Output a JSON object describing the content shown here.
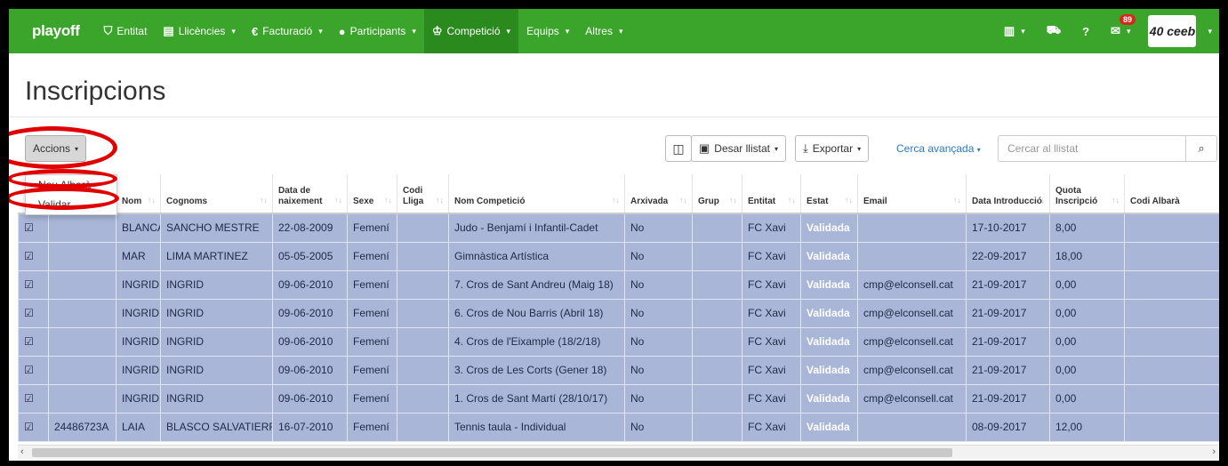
{
  "navbar": {
    "brand": "playoff",
    "items": [
      {
        "label": "Entitat",
        "icon": "⛉",
        "icon_name": "shield-icon"
      },
      {
        "label": "Llicències",
        "icon": "▤",
        "icon_name": "id-card-icon"
      },
      {
        "label": "Facturació",
        "icon": "€",
        "icon_name": "euro-icon"
      },
      {
        "label": "Participants",
        "icon": "●",
        "icon_name": "user-icon"
      },
      {
        "label": "Competició",
        "icon": "♔",
        "icon_name": "trophy-icon"
      },
      {
        "label": "Equips",
        "icon": "",
        "icon_name": ""
      },
      {
        "label": "Altres",
        "icon": "",
        "icon_name": ""
      }
    ],
    "mail_badge": "89",
    "logo_text": "40 ceeb"
  },
  "page": {
    "title": "Inscripcions"
  },
  "toolbar": {
    "actions_label": "Accions",
    "actions_menu": [
      "Nou Albarà",
      "Validar"
    ],
    "save_list": "Desar llistat",
    "export": "Exportar",
    "advanced_search": "Cerca avançada",
    "search_placeholder": "Cercar al llistat"
  },
  "table": {
    "headers": [
      "",
      "",
      "Nom",
      "Cognoms",
      "Data de naixement",
      "Sexe",
      "Codi Lliga",
      "Nom Competició",
      "Arxivada",
      "Grup",
      "Entitat",
      "Estat",
      "Email",
      "Data Introducció",
      "Quota Inscripció",
      "Codi Albarà"
    ],
    "rows": [
      [
        "☑",
        "",
        "BLANCA",
        "SANCHO MESTRE",
        "22-08-2009",
        "Femení",
        "",
        "Judo - Benjamí i Infantil-Cadet",
        "No",
        "",
        "FC Xavi",
        "Validada",
        "",
        "17-10-2017",
        "8,00",
        ""
      ],
      [
        "☑",
        "",
        "MAR",
        "LIMA MARTINEZ",
        "05-05-2005",
        "Femení",
        "",
        "Gimnàstica Artística",
        "No",
        "",
        "FC Xavi",
        "Validada",
        "",
        "22-09-2017",
        "18,00",
        ""
      ],
      [
        "☑",
        "",
        "INGRID",
        "INGRID",
        "09-06-2010",
        "Femení",
        "",
        "7. Cros de Sant Andreu (Maig 18)",
        "No",
        "",
        "FC Xavi",
        "Validada",
        "cmp@elconsell.cat",
        "21-09-2017",
        "0,00",
        ""
      ],
      [
        "☑",
        "",
        "INGRID",
        "INGRID",
        "09-06-2010",
        "Femení",
        "",
        "6. Cros de Nou Barris (Abril 18)",
        "No",
        "",
        "FC Xavi",
        "Validada",
        "cmp@elconsell.cat",
        "21-09-2017",
        "0,00",
        ""
      ],
      [
        "☑",
        "",
        "INGRID",
        "INGRID",
        "09-06-2010",
        "Femení",
        "",
        "4. Cros de l'Eixample (18/2/18)",
        "No",
        "",
        "FC Xavi",
        "Validada",
        "cmp@elconsell.cat",
        "21-09-2017",
        "0,00",
        ""
      ],
      [
        "☑",
        "",
        "INGRID",
        "INGRID",
        "09-06-2010",
        "Femení",
        "",
        "3. Cros de Les Corts (Gener 18)",
        "No",
        "",
        "FC Xavi",
        "Validada",
        "cmp@elconsell.cat",
        "21-09-2017",
        "0,00",
        ""
      ],
      [
        "☑",
        "",
        "INGRID",
        "INGRID",
        "09-06-2010",
        "Femení",
        "",
        "1. Cros de Sant Martí (28/10/17)",
        "No",
        "",
        "FC Xavi",
        "Validada",
        "cmp@elconsell.cat",
        "21-09-2017",
        "0,00",
        ""
      ],
      [
        "☑",
        "24486723A",
        "LAIA",
        "BLASCO SALVATIERRA",
        "16-07-2010",
        "Femení",
        "",
        "Tennis taula - Individual",
        "No",
        "",
        "FC Xavi",
        "Validada",
        "",
        "08-09-2017",
        "12,00",
        ""
      ]
    ]
  },
  "colors": {
    "navbar": "#3aa52a",
    "row": "#a9b6d8",
    "highlight_ring": "#e00000",
    "link": "#2a7bc0"
  }
}
